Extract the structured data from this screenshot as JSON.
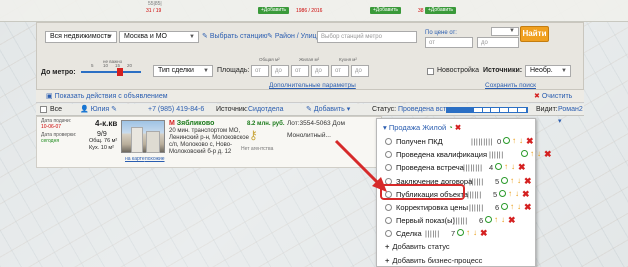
{
  "topstrip": {
    "stats": [
      "55|85|",
      "31 / 19",
      "1986 / 2016",
      "38 / 73"
    ],
    "add_buttons": [
      "+Добавить",
      "+Добавить",
      "+Добавить"
    ]
  },
  "filters": {
    "type_select": "Вся недвижимость",
    "region_select": "Москва и МО",
    "choose_station": "Выбрать станцию",
    "district_street": "Район / Улица",
    "metro_placeholder": "Выбор станций метро",
    "price_from_label": "По цене от:",
    "price_from_placeholder": "от",
    "price_to_placeholder": "до",
    "find_button": "Найти",
    "metro_label": "До метро:",
    "metro_scale": [
      "не важно",
      "5",
      "10",
      "15",
      "20"
    ],
    "deal_type": "Тип сделки",
    "area_label": "Площадь:",
    "area_total_caption": "Общая м²",
    "area_living_caption": "Жилая м²",
    "area_kitchen_caption": "Кухня м²",
    "area_placeholder": "от",
    "newbuild_label": "Новостройка",
    "sources_label": "Источники:",
    "sources_value": "Необр.",
    "more_params": "Дополнительные параметры",
    "save_search": "Сохранить поиск",
    "show_actions": "Показать действия с объявлением",
    "clear": "Очистить"
  },
  "rowhdr": {
    "select_all": "Все",
    "user": "Юлия",
    "phone": "+7 (985) 419-84-6",
    "source_label": "Источник:",
    "source_value": "Сидотдела",
    "add_label": "Добавить",
    "status_label": "Статус:",
    "status_value": "Проведена встр...",
    "view_label": "Видит:",
    "view_value": "Роман2",
    "progress_total": 9,
    "progress_filled": 3
  },
  "card": {
    "date_label": "Дата подачи:",
    "date_value": "10-06-07",
    "check_label": "Дата проверки:",
    "check_value": "сегодня",
    "rooms": "4-к.кв",
    "floor": "9/9",
    "total_area": "Общ. 76 м²",
    "kitchen_area": "Кух. 10 м²",
    "station": "Зябликово",
    "desc": "20 мин. транспортом МО, Ленинский р-н, Молоковское с/п, Молоково с, Ново-Молоковский б-р д. 12",
    "map_link": "на карте",
    "more_link": "похожие",
    "price": "8.2 млн. руб.",
    "agency_label": "Нет агентства",
    "lot": "Лот:3554-5063 Дом Монолитный..."
  },
  "popup": {
    "header": "Продажа Жилой",
    "items": [
      {
        "label": "Получен ПКД",
        "bars": "|||||||||",
        "count": "0"
      },
      {
        "label": "Проведена квалификация",
        "bars": "||||||",
        "count": ""
      },
      {
        "label": "Проведена встреча",
        "bars": "||||||||",
        "count": "4"
      },
      {
        "label": "Заключение договора",
        "bars": "||||||",
        "count": "5"
      },
      {
        "label": "Публикация объекта",
        "bars": "||||||",
        "count": "5"
      },
      {
        "label": "Корректировка цены",
        "bars": "||||||",
        "count": "6"
      },
      {
        "label": "Первый показ(ы)",
        "bars": "||||||",
        "count": "6"
      },
      {
        "label": "Сделка",
        "bars": "||||||",
        "count": "7"
      }
    ],
    "add_status": "Добавить статус",
    "add_process": "Добавить бизнес-процесс"
  },
  "colors": {
    "accent_blue": "#2a5db0",
    "highlight_red": "#d62a2a",
    "find_orange": "#f0a020",
    "ok_green": "#2a9a2a"
  }
}
